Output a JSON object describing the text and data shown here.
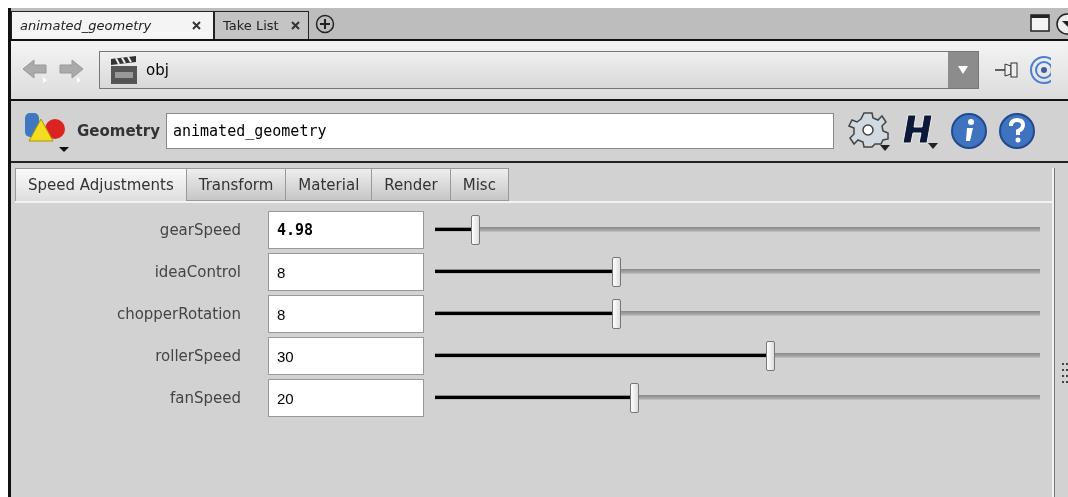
{
  "pane_tabs": [
    {
      "label": "animated_geometry",
      "selected": true
    },
    {
      "label": "Take List",
      "selected": false
    }
  ],
  "path_bar": {
    "path": "obj"
  },
  "node_header": {
    "type_label": "Geometry",
    "name": "animated_geometry"
  },
  "tabs": [
    {
      "label": "Speed Adjustments",
      "selected": true
    },
    {
      "label": "Transform",
      "selected": false
    },
    {
      "label": "Material",
      "selected": false
    },
    {
      "label": "Render",
      "selected": false
    },
    {
      "label": "Misc",
      "selected": false
    }
  ],
  "parameters": [
    {
      "name": "gearSpeed",
      "value": "4.98",
      "bold": true,
      "level": 0.068
    },
    {
      "name": "ideaControl",
      "value": "8",
      "bold": false,
      "level": 0.3
    },
    {
      "name": "chopperRotation",
      "value": "8",
      "bold": false,
      "level": 0.3
    },
    {
      "name": "rollerSpeed",
      "value": "30",
      "bold": false,
      "level": 0.555
    },
    {
      "name": "fanSpeed",
      "value": "20",
      "bold": false,
      "level": 0.33
    }
  ]
}
